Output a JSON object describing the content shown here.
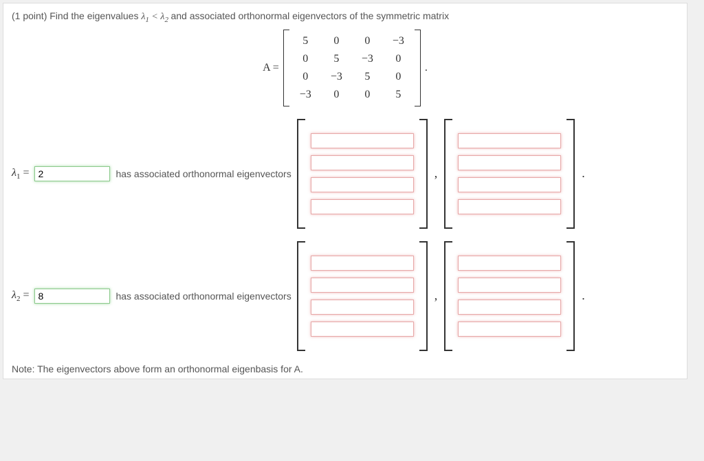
{
  "prompt": {
    "points_label": "(1 point)",
    "text_before": "Find the eigenvalues",
    "ineq": "λ₁ < λ₂",
    "text_after": "and associated orthonormal eigenvectors of the symmetric matrix"
  },
  "matrix": {
    "label": "A =",
    "rows": [
      [
        "5",
        "0",
        "0",
        "−3"
      ],
      [
        "0",
        "5",
        "−3",
        "0"
      ],
      [
        "0",
        "−3",
        "5",
        "0"
      ],
      [
        "−3",
        "0",
        "0",
        "5"
      ]
    ],
    "trailing": "."
  },
  "rows": [
    {
      "lambda_label": "λ₁ =",
      "lambda_value": "2",
      "mid_text": "has associated orthonormal eigenvectors",
      "vec1": [
        "",
        "",
        "",
        ""
      ],
      "vec2": [
        "",
        "",
        "",
        ""
      ],
      "comma": ",",
      "period": "."
    },
    {
      "lambda_label": "λ₂ =",
      "lambda_value": "8",
      "mid_text": "has associated orthonormal eigenvectors",
      "vec1": [
        "",
        "",
        "",
        ""
      ],
      "vec2": [
        "",
        "",
        "",
        ""
      ],
      "comma": ",",
      "period": "."
    }
  ],
  "note": "Note: The eigenvectors above form an orthonormal eigenbasis for A."
}
